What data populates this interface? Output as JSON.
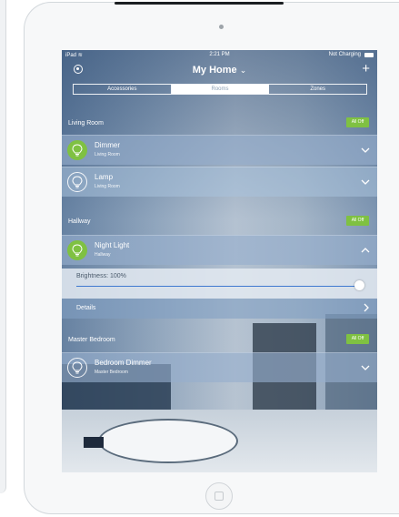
{
  "statusbar": {
    "carrier": "iPad",
    "wifi_icon": "wifi-icon",
    "time": "2:21 PM",
    "battery_text": "Not Charging"
  },
  "navbar": {
    "title": "My Home",
    "title_chevron": "⌄",
    "add_label": "+"
  },
  "tabs": [
    {
      "label": "Accessories",
      "active": false
    },
    {
      "label": "Rooms",
      "active": true
    },
    {
      "label": "Zones",
      "active": false
    }
  ],
  "sections": {
    "living_room": {
      "title": "Living Room",
      "all_off": "All Off",
      "items": [
        {
          "name": "Dimmer",
          "room": "Living Room",
          "on": true
        },
        {
          "name": "Lamp",
          "room": "Living Room",
          "on": false
        }
      ]
    },
    "hallway": {
      "title": "Hallway",
      "all_off": "All Off",
      "items": [
        {
          "name": "Night Light",
          "room": "Hallway",
          "on": true
        }
      ],
      "brightness_label": "Brightness: 100%",
      "brightness_level": 1.0,
      "details_label": "Details"
    },
    "master_bedroom": {
      "title": "Master Bedroom",
      "all_off": "All Off",
      "items": [
        {
          "name": "Bedroom Dimmer",
          "room": "Master Bedroom",
          "on": false
        }
      ]
    }
  },
  "colors": {
    "accent_green": "#7fc142",
    "slider_blue": "#3f79d0"
  }
}
